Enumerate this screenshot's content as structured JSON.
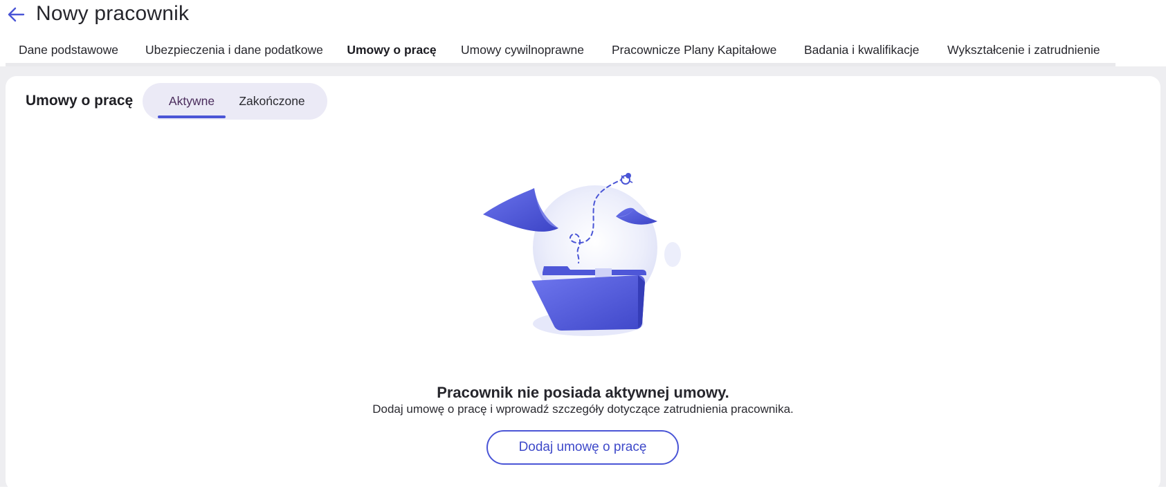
{
  "header": {
    "back_icon": "arrow-left-icon",
    "title": "Nowy pracownik"
  },
  "tabs": [
    {
      "label": "Dane podstawowe",
      "active": false
    },
    {
      "label": "Ubezpieczenia i dane podatkowe",
      "active": false
    },
    {
      "label": "Umowy o pracę",
      "active": true
    },
    {
      "label": "Umowy cywilnoprawne",
      "active": false
    },
    {
      "label": "Pracownicze Plany Kapitałowe",
      "active": false
    },
    {
      "label": "Badania i kwalifikacje",
      "active": false
    },
    {
      "label": "Wykształcenie i zatrudnienie",
      "active": false
    }
  ],
  "section": {
    "title": "Umowy o pracę",
    "filters": [
      {
        "label": "Aktywne",
        "active": true
      },
      {
        "label": "Zakończone",
        "active": false
      }
    ]
  },
  "empty_state": {
    "illustration": "empty-folder-illustration",
    "title": "Pracownik nie posiada aktywnej umowy.",
    "description": "Dodaj umowę o pracę i wprowadź szczegóły dotyczące zatrudnienia pracownika.",
    "button_label": "Dodaj umowę o pracę"
  },
  "colors": {
    "accent": "#4a55d6",
    "illustration_primary": "#5b63e6",
    "background": "#eeeef1"
  }
}
